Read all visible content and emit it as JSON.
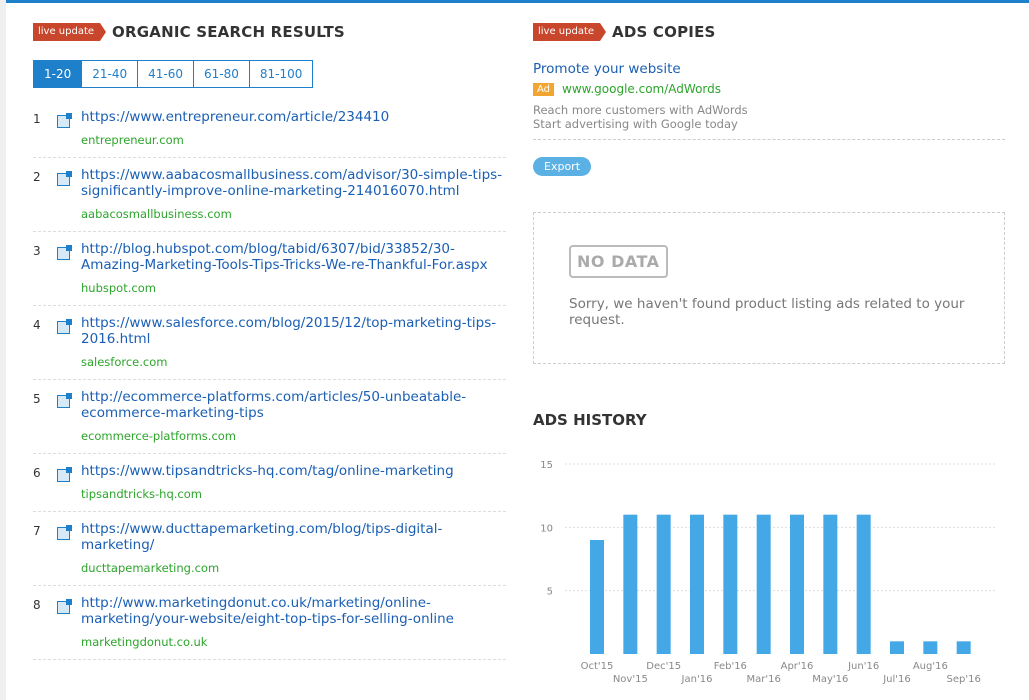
{
  "organic": {
    "badge": "live update",
    "title": "ORGANIC SEARCH RESULTS",
    "pages": [
      "1-20",
      "21-40",
      "41-60",
      "61-80",
      "81-100"
    ],
    "results": [
      {
        "num": "1",
        "url": "https://www.entrepreneur.com/article/234410",
        "domain": "entrepreneur.com"
      },
      {
        "num": "2",
        "url": "https://www.aabacosmallbusiness.com/advisor/30-simple-tips-significantly-improve-online-marketing-214016070.html",
        "domain": "aabacosmallbusiness.com"
      },
      {
        "num": "3",
        "url": "http://blog.hubspot.com/blog/tabid/6307/bid/33852/30-Amazing-Marketing-Tools-Tips-Tricks-We-re-Thankful-For.aspx",
        "domain": "hubspot.com"
      },
      {
        "num": "4",
        "url": "https://www.salesforce.com/blog/2015/12/top-marketing-tips-2016.html",
        "domain": "salesforce.com"
      },
      {
        "num": "5",
        "url": "http://ecommerce-platforms.com/articles/50-unbeatable-ecommerce-marketing-tips",
        "domain": "ecommerce-platforms.com"
      },
      {
        "num": "6",
        "url": "https://www.tipsandtricks-hq.com/tag/online-marketing",
        "domain": "tipsandtricks-hq.com"
      },
      {
        "num": "7",
        "url": "https://www.ducttapemarketing.com/blog/tips-digital-marketing/",
        "domain": "ducttapemarketing.com"
      },
      {
        "num": "8",
        "url": "http://www.marketingdonut.co.uk/marketing/online-marketing/your-website/eight-top-tips-for-selling-online",
        "domain": "marketingdonut.co.uk"
      }
    ]
  },
  "ads": {
    "badge": "live update",
    "title": "ADS COPIES",
    "ad_title": "Promote your website",
    "ad_tag": "Ad",
    "ad_site": "www.google.com/AdWords",
    "ad_line1": "Reach more customers with AdWords",
    "ad_line2": "Start advertising with Google today",
    "export_label": "Export",
    "nodata_stamp": "NO DATA",
    "nodata_message": "Sorry, we haven't found product listing ads related to your request."
  },
  "history": {
    "title": "ADS HISTORY"
  },
  "chart_data": {
    "type": "bar",
    "categories": [
      "Oct'15",
      "Nov'15",
      "Dec'15",
      "Jan'16",
      "Feb'16",
      "Mar'16",
      "Apr'16",
      "May'16",
      "Jun'16",
      "Jul'16",
      "Aug'16",
      "Sep'16"
    ],
    "values": [
      9,
      11,
      11,
      11,
      11,
      11,
      11,
      11,
      11,
      1,
      1,
      1
    ],
    "yticks": [
      5,
      10,
      15
    ],
    "ylim": [
      0,
      15
    ],
    "grid": true,
    "color": "#45a8e6"
  },
  "colors": {
    "accent": "#1e7fcb",
    "link": "#1a5fb4",
    "domain_green": "#2da52b",
    "badge_red": "#c8462b",
    "ad_orange": "#f2a531"
  }
}
